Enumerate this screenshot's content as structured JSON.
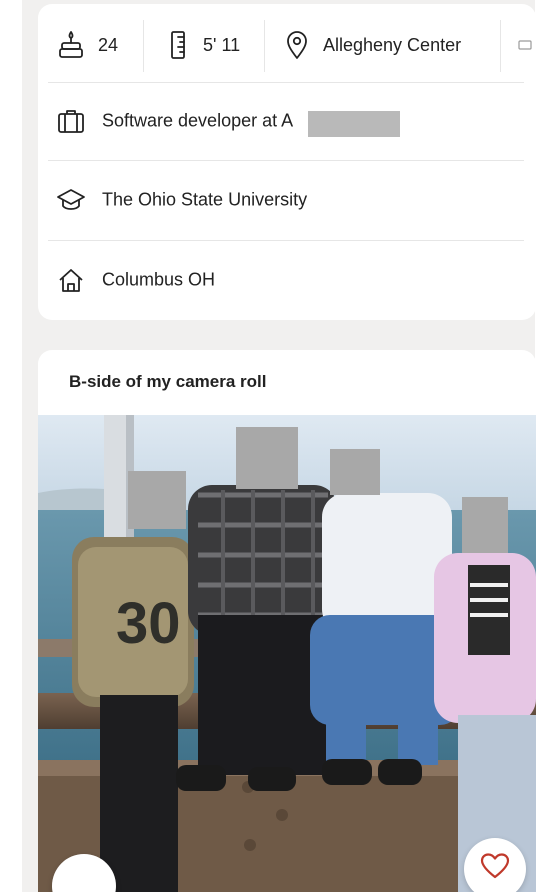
{
  "profile": {
    "stats": {
      "age": "24",
      "age_icon": "cake-icon",
      "height": "5' 11",
      "height_icon": "ruler-icon",
      "location": "Allegheny Center",
      "location_icon": "location-pin-icon"
    },
    "details": [
      {
        "icon": "briefcase-icon",
        "label": "Software developer at A"
      },
      {
        "icon": "graduation-cap-icon",
        "label": "The Ohio State University"
      },
      {
        "icon": "home-icon",
        "label": "Columbus OH"
      }
    ]
  },
  "prompt": {
    "title": "B-side of my camera roll"
  },
  "actions": {
    "like_icon": "heart-icon",
    "skip_icon": "close-icon"
  },
  "colors": {
    "background": "#f1f0ef",
    "card": "#ffffff",
    "text": "#222222",
    "divider": "#e6e6e6",
    "redaction": "#b9b9b9",
    "like_accent": "#c0392b"
  }
}
